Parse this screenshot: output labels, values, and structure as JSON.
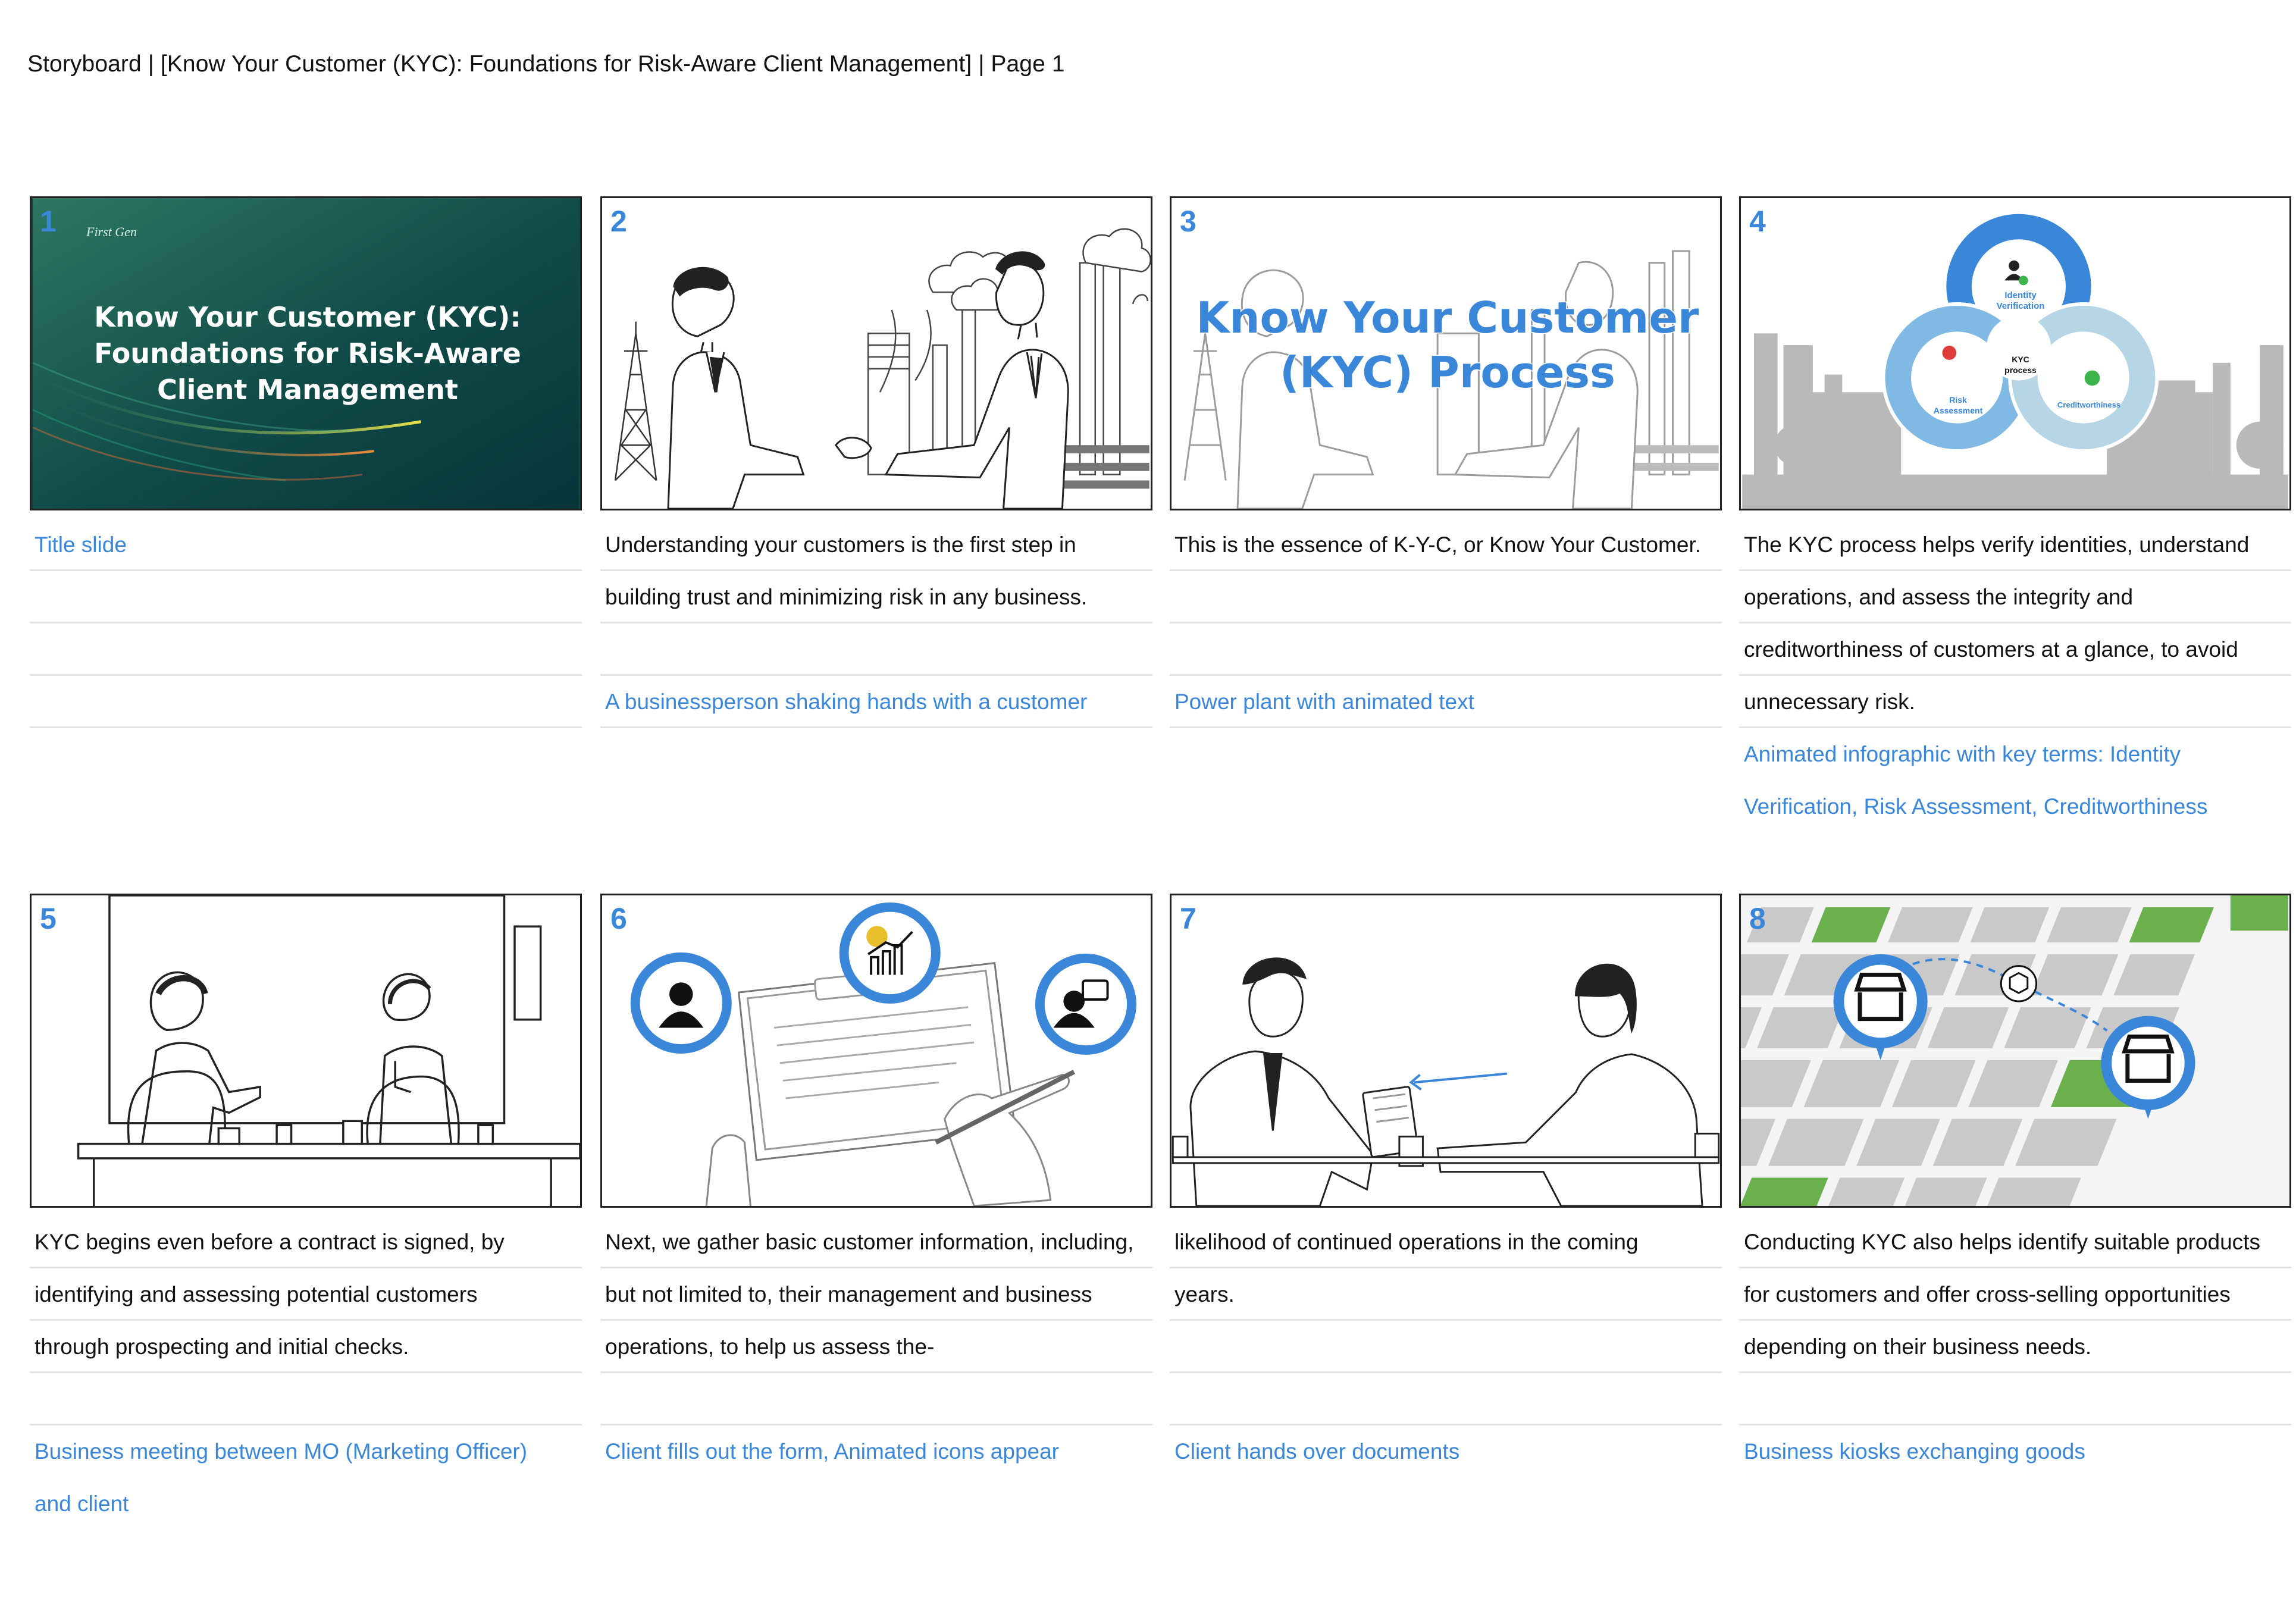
{
  "header": {
    "title": "Storyboard | [Know Your Customer (KYC): Foundations for Risk-Aware Client Management] | Page 1"
  },
  "panels": [
    {
      "number": "1",
      "slide": {
        "logo": "First Gen",
        "title": [
          "Know Your Customer (KYC):",
          "Foundations for Risk-Aware",
          "Client Management"
        ]
      },
      "lines": [
        {
          "text": "Title slide",
          "style": "blue"
        },
        {
          "text": "",
          "style": "empty"
        },
        {
          "text": "",
          "style": "empty"
        },
        {
          "text": "",
          "style": "empty"
        }
      ]
    },
    {
      "number": "2",
      "lines": [
        {
          "text": "Understanding your customers is the first step in",
          "style": "black"
        },
        {
          "text": "building trust and minimizing risk in any business.",
          "style": "black"
        },
        {
          "text": "",
          "style": "empty"
        },
        {
          "text": "A businessperson shaking hands with a customer",
          "style": "blue"
        }
      ]
    },
    {
      "number": "3",
      "overlay_text": [
        "Know Your Customer",
        "(KYC) Process"
      ],
      "lines": [
        {
          "text": "This is the essence of K-Y-C, or Know Your Customer.",
          "style": "black"
        },
        {
          "text": "",
          "style": "empty"
        },
        {
          "text": "",
          "style": "empty"
        },
        {
          "text": "Power plant with animated text",
          "style": "blue"
        }
      ]
    },
    {
      "number": "4",
      "infographic": {
        "top": [
          "Identity",
          "Verification"
        ],
        "center": [
          "KYC",
          "process"
        ],
        "left": [
          "Risk",
          "Assessment"
        ],
        "right": "Creditworthiness"
      },
      "lines": [
        {
          "text": "The KYC process helps verify identities, understand",
          "style": "black"
        },
        {
          "text": "operations, and assess the integrity and",
          "style": "black"
        },
        {
          "text": "creditworthiness of customers at a glance, to avoid",
          "style": "black"
        },
        {
          "text": "unnecessary risk.",
          "style": "black"
        },
        {
          "text": "Animated infographic with key terms: Identity",
          "style": "blue"
        },
        {
          "text": "Verification, Risk Assessment, Creditworthiness",
          "style": "blue"
        }
      ]
    },
    {
      "number": "5",
      "lines": [
        {
          "text": "KYC begins even before a contract is signed, by",
          "style": "black"
        },
        {
          "text": "identifying and assessing potential customers",
          "style": "black"
        },
        {
          "text": "through prospecting and initial checks.",
          "style": "black"
        },
        {
          "text": "",
          "style": "empty"
        },
        {
          "text": "Business meeting between MO (Marketing Officer)",
          "style": "blue"
        },
        {
          "text": "and client",
          "style": "blue"
        }
      ]
    },
    {
      "number": "6",
      "lines": [
        {
          "text": "Next, we gather basic customer information, including,",
          "style": "black"
        },
        {
          "text": "but not limited to, their management and business",
          "style": "black"
        },
        {
          "text": "operations, to help us assess the-",
          "style": "black"
        },
        {
          "text": "",
          "style": "empty"
        },
        {
          "text": "Client fills out the form, Animated icons appear",
          "style": "blue"
        }
      ]
    },
    {
      "number": "7",
      "lines": [
        {
          "text": "likelihood of continued operations in the coming",
          "style": "black"
        },
        {
          "text": "years.",
          "style": "black"
        },
        {
          "text": "",
          "style": "empty"
        },
        {
          "text": "",
          "style": "empty"
        },
        {
          "text": "Client hands over documents",
          "style": "blue"
        }
      ]
    },
    {
      "number": "8",
      "lines": [
        {
          "text": "Conducting KYC also helps identify suitable products",
          "style": "black"
        },
        {
          "text": "for customers and offer cross-selling opportunities",
          "style": "black"
        },
        {
          "text": "depending on their business needs.",
          "style": "black"
        },
        {
          "text": "",
          "style": "empty"
        },
        {
          "text": "Business kiosks exchanging goods",
          "style": "blue"
        }
      ]
    }
  ]
}
